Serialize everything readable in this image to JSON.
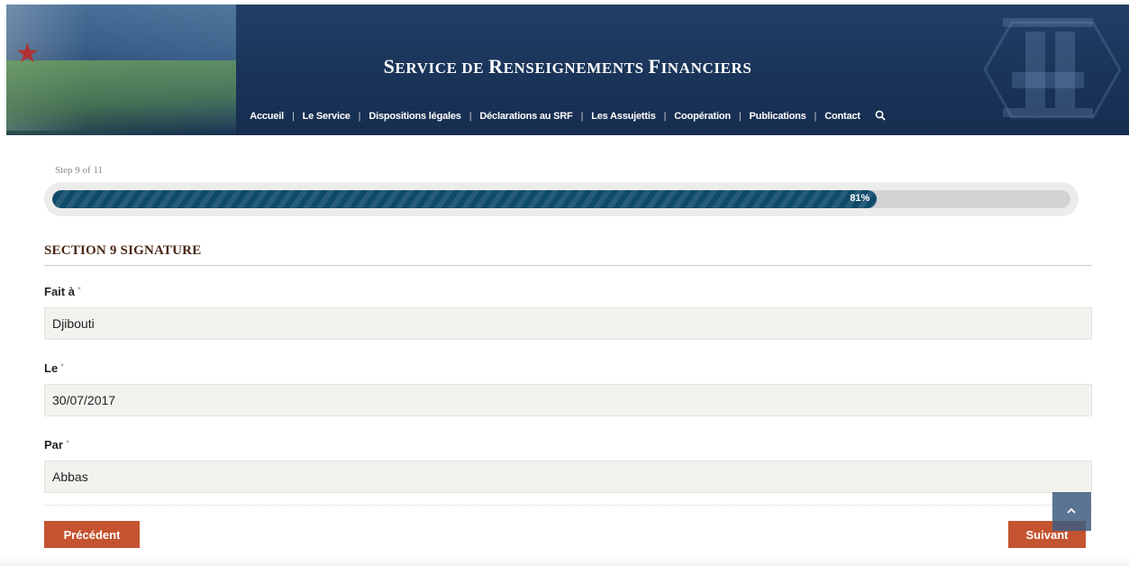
{
  "header": {
    "title_parts": [
      {
        "cap": "S",
        "rest": "ERVICE DE "
      },
      {
        "cap": "R",
        "rest": "ENSEIGNEMENTS "
      },
      {
        "cap": "F",
        "rest": "INANCIERS"
      }
    ],
    "nav": [
      "Accueil",
      "Le Service",
      "Dispositions légales",
      "Déclarations au SRF",
      "Les Assujettis",
      "Coopération",
      "Publications",
      "Contact"
    ],
    "search_icon": "search-icon"
  },
  "progress": {
    "step_label": "Step 9 of 11",
    "percent": 81,
    "percent_label": "81%"
  },
  "section": {
    "title": "SECTION 9 SIGNATURE"
  },
  "fields": [
    {
      "label": "Fait à",
      "required_mark": "*",
      "value": "Djibouti"
    },
    {
      "label": "Le",
      "required_mark": "*",
      "value": "30/07/2017"
    },
    {
      "label": "Par",
      "required_mark": "*",
      "value": "Abbas"
    }
  ],
  "buttons": {
    "previous": "Précédent",
    "next": "Suivant"
  },
  "colors": {
    "header_bg": "#1a3459",
    "progress_fill": "#0e4a6a",
    "button_bg": "#c4532f",
    "section_title": "#4a2817"
  }
}
